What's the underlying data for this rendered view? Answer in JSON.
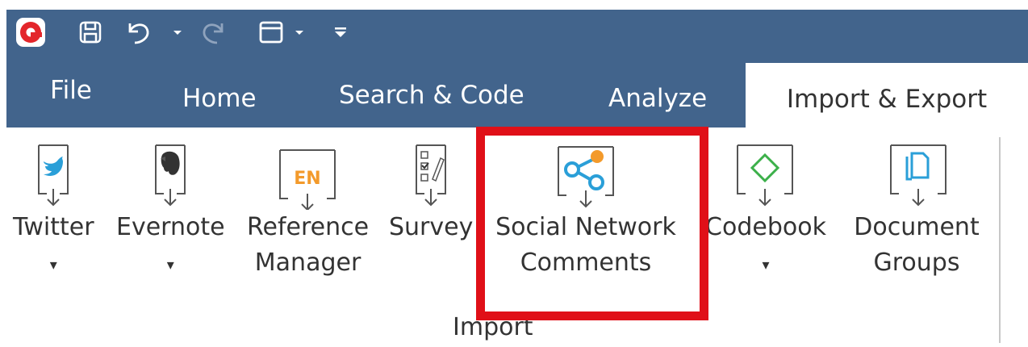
{
  "app": {
    "logo": "app-logo-icon"
  },
  "quick_access": [
    {
      "name": "save-icon"
    },
    {
      "name": "undo-icon"
    },
    {
      "name": "redo-icon"
    },
    {
      "name": "window-icon"
    },
    {
      "name": "customize-icon"
    }
  ],
  "tabs": {
    "file": "File",
    "home": "Home",
    "search_code": "Search & Code",
    "analyze": "Analyze",
    "import_export": "Import & Export"
  },
  "ribbon": {
    "group_label": "Import",
    "buttons": [
      {
        "line1": "Twitter",
        "line2": "",
        "has_dropdown": true,
        "icon": "twitter-icon"
      },
      {
        "line1": "Evernote",
        "line2": "",
        "has_dropdown": true,
        "icon": "evernote-icon"
      },
      {
        "line1": "Reference",
        "line2": "Manager",
        "has_dropdown": false,
        "icon": "reference-manager-icon"
      },
      {
        "line1": "Survey",
        "line2": "",
        "has_dropdown": false,
        "icon": "survey-icon"
      },
      {
        "line1": "Social Network",
        "line2": "Comments",
        "has_dropdown": false,
        "icon": "share-icon",
        "highlighted": true
      },
      {
        "line1": "Codebook",
        "line2": "",
        "has_dropdown": true,
        "icon": "codebook-icon"
      },
      {
        "line1": "Document",
        "line2": "Groups",
        "has_dropdown": false,
        "icon": "document-groups-icon"
      }
    ],
    "reference_icon_text": "EN",
    "dropdown_glyph": "▾"
  },
  "colors": {
    "titlebar": "#42648c",
    "highlight": "#e01018",
    "icon_blue": "#2a9fd8",
    "icon_orange": "#f39a2b",
    "icon_green": "#3cb04a",
    "text": "#333333"
  }
}
